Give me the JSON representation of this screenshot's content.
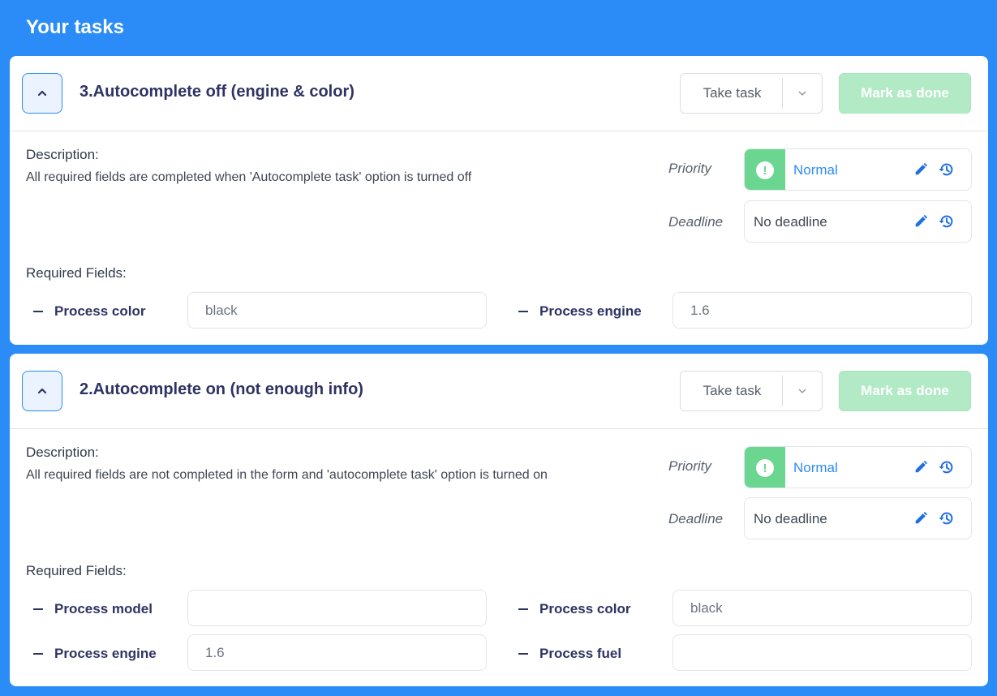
{
  "header": {
    "title": "Your tasks"
  },
  "labels": {
    "description": "Description:",
    "priority": "Priority",
    "deadline": "Deadline",
    "required_fields": "Required Fields:",
    "take_task": "Take task",
    "mark_as_done": "Mark as done"
  },
  "colors": {
    "panel": "#2b8cf8",
    "priority_green": "#6ad68f",
    "mark_done_disabled": "#b3eac6",
    "title_navy": "#2e3363"
  },
  "tasks": [
    {
      "title": "3.Autocomplete off (engine & color)",
      "description": "All required fields are completed when 'Autocomplete task' option is turned off",
      "priority": "Normal",
      "deadline": "No deadline",
      "fields": [
        {
          "name": "Process color",
          "value": "black"
        },
        {
          "name": "Process engine",
          "value": "1.6"
        }
      ]
    },
    {
      "title": "2.Autocomplete on (not enough info)",
      "description": "All required fields are not completed in the form and 'autocomplete task' option is turned on",
      "priority": "Normal",
      "deadline": "No deadline",
      "fields": [
        {
          "name": "Process model",
          "value": ""
        },
        {
          "name": "Process color",
          "value": "black"
        },
        {
          "name": "Process engine",
          "value": "1.6"
        },
        {
          "name": "Process fuel",
          "value": ""
        }
      ]
    }
  ]
}
